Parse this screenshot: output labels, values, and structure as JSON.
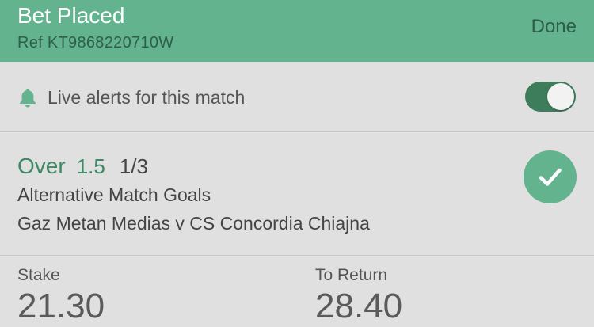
{
  "header": {
    "title": "Bet Placed",
    "ref": "Ref KT9868220710W",
    "done_label": "Done"
  },
  "alerts": {
    "label": "Live alerts for this match",
    "toggle_on": true,
    "icon": "bell-icon"
  },
  "selection": {
    "name": "Over",
    "handicap": "1.5",
    "odds": "1/3",
    "market": "Alternative Match Goals",
    "event": "Gaz Metan Medias v CS Concordia Chiajna",
    "status_icon": "check-icon"
  },
  "totals": {
    "stake_label": "Stake",
    "stake_value": "21.30",
    "return_label": "To Return",
    "return_value": "28.40"
  },
  "colors": {
    "header_bg": "#63b38f",
    "accent_green": "#3e8a66",
    "toggle_on": "#3d7d5c",
    "background": "#e0e0e0"
  }
}
